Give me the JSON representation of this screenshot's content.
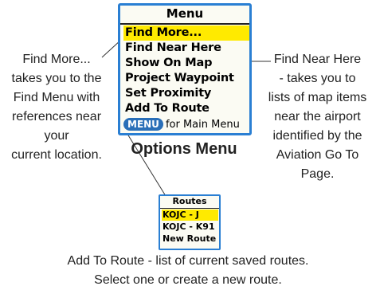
{
  "menu": {
    "title": "Menu",
    "items": [
      {
        "label": "Find More...",
        "selected": true
      },
      {
        "label": "Find Near Here",
        "selected": false
      },
      {
        "label": "Show On Map",
        "selected": false
      },
      {
        "label": "Project Waypoint",
        "selected": false
      },
      {
        "label": "Set Proximity",
        "selected": false
      },
      {
        "label": "Add To Route",
        "selected": false
      }
    ],
    "footer_key": "MENU",
    "footer_text": "for Main Menu"
  },
  "caption": "Options Menu",
  "routes": {
    "title": "Routes",
    "items": [
      {
        "label": "KOJC - J",
        "selected": true
      },
      {
        "label": "KOJC - K91",
        "selected": false
      },
      {
        "label": "New Route",
        "selected": false
      }
    ]
  },
  "annotations": {
    "left": [
      "Find More...",
      "takes you to the",
      "Find Menu with",
      "references near",
      "your",
      "current location."
    ],
    "right": [
      "Find Near Here",
      "- takes you to",
      "lists of map items",
      "near the airport",
      "identified by the",
      "Aviation Go To",
      "Page."
    ],
    "bottom": [
      "Add To Route - list of current saved routes.",
      "Select one or create a new route."
    ]
  },
  "colors": {
    "accent": "#2a7fd3",
    "highlight": "#ffea00",
    "key": "#2a6fb8"
  }
}
